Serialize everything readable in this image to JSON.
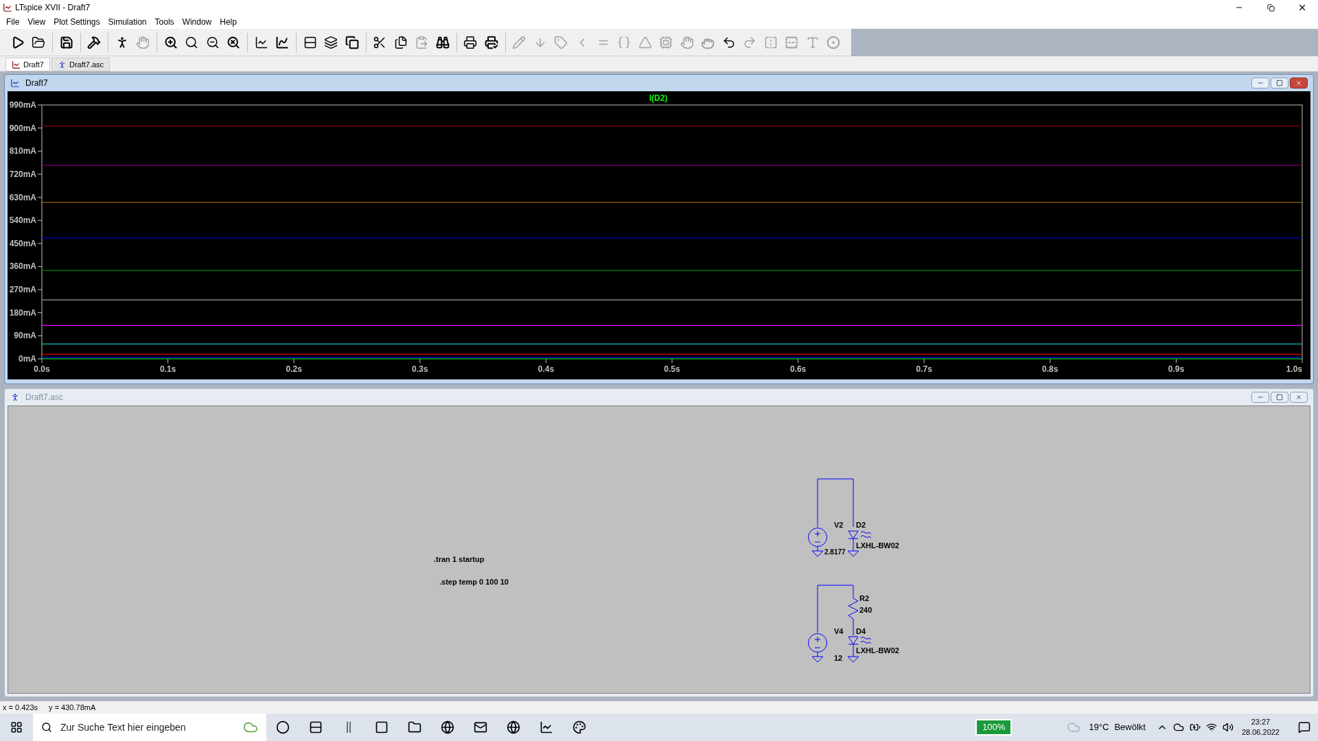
{
  "window": {
    "title": "LTspice XVII - Draft7"
  },
  "menu": [
    "File",
    "View",
    "Plot Settings",
    "Simulation",
    "Tools",
    "Window",
    "Help"
  ],
  "toolbar": [
    {
      "disabled": false
    },
    {
      "disabled": false
    },
    {
      "disabled": false
    },
    {
      "disabled": false
    },
    {
      "disabled": false
    },
    {
      "disabled": true
    },
    {
      "disabled": false
    },
    {
      "disabled": false
    },
    {
      "disabled": false
    },
    {
      "disabled": false
    },
    {
      "disabled": false
    },
    {
      "disabled": false
    },
    {
      "disabled": false
    },
    {
      "disabled": false
    },
    {
      "disabled": false
    },
    {
      "disabled": false
    },
    {
      "disabled": false
    },
    {
      "disabled": true
    },
    {
      "disabled": false
    },
    {
      "disabled": false
    },
    {
      "disabled": false
    },
    {
      "disabled": true
    },
    {
      "disabled": true
    },
    {
      "disabled": true
    },
    {
      "disabled": true
    },
    {
      "disabled": true
    },
    {
      "disabled": true
    },
    {
      "disabled": true
    },
    {
      "disabled": true
    },
    {
      "disabled": true
    },
    {
      "disabled": true
    },
    {
      "disabled": false
    },
    {
      "disabled": true
    },
    {
      "disabled": true
    },
    {
      "disabled": true
    },
    {
      "disabled": true
    },
    {
      "disabled": true
    }
  ],
  "tabs": [
    {
      "label": "Draft7",
      "kind": "plot",
      "selected": true
    },
    {
      "label": "Draft7.asc",
      "kind": "schematic",
      "selected": false
    }
  ],
  "plot_window": {
    "title": "Draft7",
    "active": true,
    "chart_data": {
      "type": "line",
      "title": "I(D2)",
      "x": [
        0,
        1
      ],
      "series": [
        {
          "color": "#800000",
          "values": [
            908,
            908
          ]
        },
        {
          "color": "#800080",
          "values": [
            755,
            755
          ]
        },
        {
          "color": "#c08000",
          "values": [
            610,
            610
          ]
        },
        {
          "color": "#0000c0",
          "values": [
            471,
            471
          ]
        },
        {
          "color": "#008000",
          "values": [
            345,
            345
          ]
        },
        {
          "color": "#a0a0a0",
          "values": [
            230,
            230
          ]
        },
        {
          "color": "#ff00ff",
          "values": [
            130,
            130
          ]
        },
        {
          "color": "#00c0c0",
          "values": [
            58,
            58
          ]
        },
        {
          "color": "#ff0000",
          "values": [
            18,
            18
          ]
        },
        {
          "color": "#0000ff",
          "values": [
            5,
            5
          ]
        },
        {
          "color": "#00ff00",
          "values": [
            0,
            0
          ]
        }
      ],
      "xlim": [
        0,
        1
      ],
      "ylim": [
        0,
        990
      ],
      "xticks": [
        {
          "value": 0,
          "label": "0.0s"
        },
        {
          "value": 0.1,
          "label": "0.1s"
        },
        {
          "value": 0.2,
          "label": "0.2s"
        },
        {
          "value": 0.3,
          "label": "0.3s"
        },
        {
          "value": 0.4,
          "label": "0.4s"
        },
        {
          "value": 0.5,
          "label": "0.5s"
        },
        {
          "value": 0.6,
          "label": "0.6s"
        },
        {
          "value": 0.7,
          "label": "0.7s"
        },
        {
          "value": 0.8,
          "label": "0.8s"
        },
        {
          "value": 0.9,
          "label": "0.9s"
        },
        {
          "value": 1,
          "label": "1.0s"
        }
      ],
      "yticks": [
        {
          "value": 0,
          "label": "0mA"
        },
        {
          "value": 90,
          "label": "90mA"
        },
        {
          "value": 180,
          "label": "180mA"
        },
        {
          "value": 270,
          "label": "270mA"
        },
        {
          "value": 360,
          "label": "360mA"
        },
        {
          "value": 450,
          "label": "450mA"
        },
        {
          "value": 540,
          "label": "540mA"
        },
        {
          "value": 630,
          "label": "630mA"
        },
        {
          "value": 720,
          "label": "720mA"
        },
        {
          "value": 810,
          "label": "810mA"
        },
        {
          "value": 900,
          "label": "900mA"
        },
        {
          "value": 990,
          "label": "990mA"
        }
      ]
    }
  },
  "schematic_window": {
    "title": "Draft7.asc",
    "active": false,
    "directives": [
      ".tran 1 startup",
      ".step temp 0 100 10"
    ],
    "labels": {
      "v2": "V2",
      "v2_value": "2.8177",
      "d2": "D2",
      "d2_model": "LXHL-BW02",
      "r2": "R2",
      "r2_value": "240",
      "v4": "V4",
      "v4_value": "12",
      "d4": "D4",
      "d4_model": "LXHL-BW02"
    }
  },
  "status_bar": {
    "x": "x = 0.423s",
    "y": "y = 430.78mA"
  },
  "taskbar": {
    "search_placeholder": "Zur Suche Text hier eingeben",
    "battery": "100%",
    "temperature": "19°C",
    "weather": "Bewölkt",
    "time": "23:27",
    "date": "28.06.2022"
  }
}
